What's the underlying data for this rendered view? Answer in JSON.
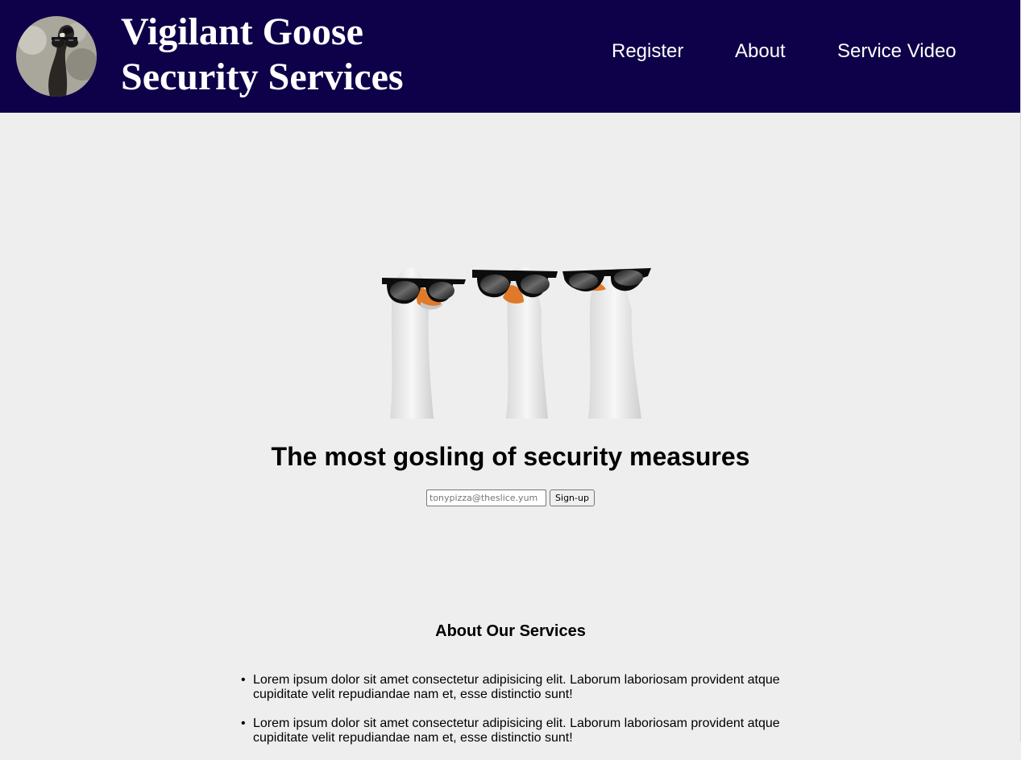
{
  "header": {
    "brand_line1": "Vigilant Goose",
    "brand_line2": "Security Services",
    "nav": {
      "register": "Register",
      "about": "About",
      "service_video": "Service Video"
    }
  },
  "hero": {
    "tagline": "The most gosling of security measures",
    "email_placeholder": "tonypizza@theslice.yum",
    "signup_label": "Sign-up"
  },
  "about": {
    "title": "About Our Services",
    "items": [
      "Lorem ipsum dolor sit amet consectetur adipisicing elit. Laborum laboriosam provident atque cupiditate velit repudiandae nam et, esse distinctio sunt!",
      "Lorem ipsum dolor sit amet consectetur adipisicing elit. Laborum laboriosam provident atque cupiditate velit repudiandae nam et, esse distinctio sunt!"
    ]
  },
  "colors": {
    "header_bg": "#0e0049",
    "page_bg": "#eeeeee",
    "text_light": "#ffffff"
  },
  "icons": {
    "logo": "goose-with-sunglasses-logo",
    "hero": "three-geese-with-sunglasses-image"
  }
}
